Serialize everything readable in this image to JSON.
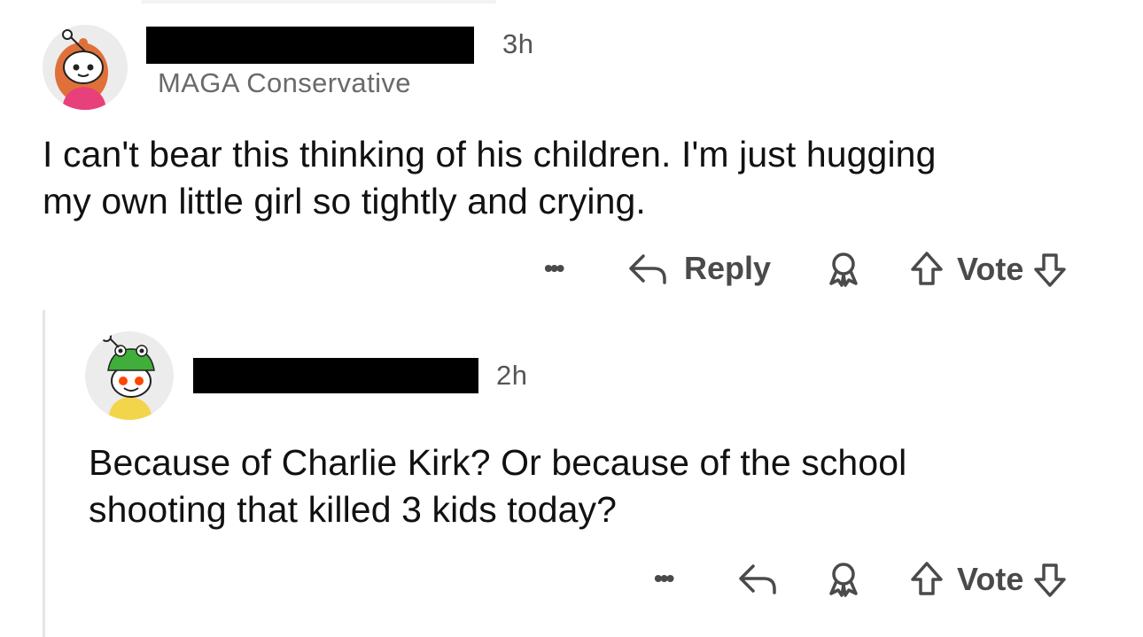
{
  "comment": {
    "avatar_icon": "snoo-avatar-redhair-icon",
    "time": "3h",
    "flair": "MAGA Conservative",
    "body_line1": "I can't bear this thinking of his children. I'm just hugging",
    "body_line2": "my own little girl so tightly and crying.",
    "actions": {
      "more_icon": "more-dots-icon",
      "reply_label": "Reply",
      "award_icon": "award-icon",
      "vote_label": "Vote"
    }
  },
  "reply": {
    "avatar_icon": "snoo-avatar-frog-hat-icon",
    "time": "2h",
    "body_line1": "Because of Charlie Kirk? Or because of the school",
    "body_line2": "shooting that killed 3 kids today?",
    "actions": {
      "more_icon": "more-dots-icon",
      "reply_icon": "reply-arrow-icon",
      "award_icon": "award-icon",
      "vote_label": "Vote"
    }
  },
  "colors": {
    "text": "#111111",
    "muted": "#6a6a6a",
    "action": "#4a4a4a",
    "redaction": "#000000"
  }
}
